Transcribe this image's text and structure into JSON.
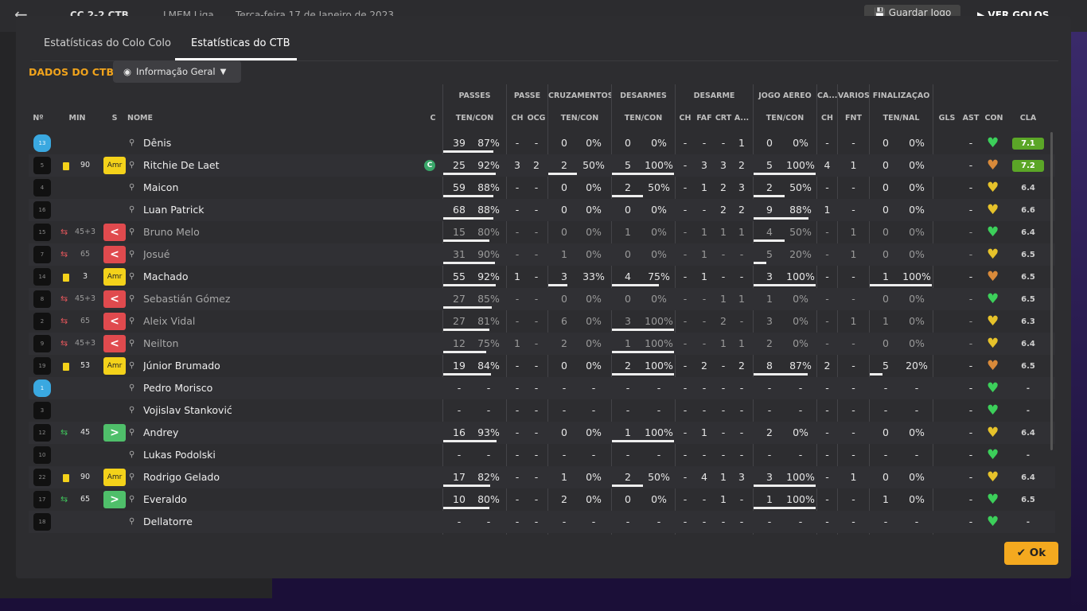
{
  "background": {
    "back_icon": "arrow-left-icon",
    "match_title": "CC 2-2 CTB",
    "competition": "LMEM Liga",
    "date": "Terça-feira 17 de Janeiro de 2023",
    "save_label": "Guardar Jogo",
    "next_label": "VER GOLOS"
  },
  "tabs": [
    {
      "label": "Estatísticas do Colo Colo"
    },
    {
      "label": "Estatísticas do CTB"
    }
  ],
  "section_title": "DADOS DO CTB",
  "view_dropdown": {
    "label": "Informação Geral",
    "icon": "eye-icon"
  },
  "group_headers": [
    {
      "key": "passes",
      "label": "PASSES"
    },
    {
      "key": "passe",
      "label": "PASSE"
    },
    {
      "key": "cruz",
      "label": "CRUZAMENTOS"
    },
    {
      "key": "desarmes",
      "label": "DESARMES"
    },
    {
      "key": "desarme",
      "label": "DESARME"
    },
    {
      "key": "aereo",
      "label": "JOGO AÉREO"
    },
    {
      "key": "ca",
      "label": "CA..."
    },
    {
      "key": "varios",
      "label": "VÁRIOS"
    },
    {
      "key": "final",
      "label": "FINALIZAÇÃO"
    }
  ],
  "columns": {
    "num": "Nº",
    "min": "MIN",
    "s": "S",
    "name": "NOME",
    "c": "C",
    "passes": "TEN/CON",
    "pch": "CH",
    "pocg": "OCG",
    "cruz": "TEN/CON",
    "des": "TEN/CON",
    "dch": "CH",
    "dfaf": "FAF",
    "dcrt": "CRT",
    "da": "A...",
    "aereo": "TEN/CON",
    "cach": "CH",
    "fnt": "FNT",
    "fin": "TEN/NAL",
    "gls": "GLS",
    "ast": "AST",
    "con": "CON",
    "cla": "CLA"
  },
  "colors": {
    "accent": "#f0a31c",
    "yellow_card": "#f4d21a",
    "sub_off": "#e04a4e",
    "sub_on": "#4fbf6a",
    "rating_high": "#5ba627",
    "heart_green": "#3ccf5a",
    "heart_yellow": "#e6c22a",
    "heart_orange": "#d98a3a"
  },
  "players": [
    {
      "num": "13",
      "gk": true,
      "min": "",
      "yellow": false,
      "sub": "",
      "badge": "",
      "name": "Dênis",
      "cap": false,
      "p_ten": "39",
      "p_pct": "87%",
      "p_bar": 0.87,
      "pch": "-",
      "pocg": "-",
      "c_ten": "0",
      "c_pct": "0%",
      "c_bar": 0,
      "d_ten": "0",
      "d_pct": "0%",
      "d_bar": 0,
      "dch": "-",
      "faf": "-",
      "crt": "-",
      "da": "1",
      "a_ten": "0",
      "a_pct": "0%",
      "a_bar": 0,
      "cach": "-",
      "fnt": "-",
      "f_ten": "0",
      "f_pct": "0%",
      "f_bar": 0,
      "gls": "",
      "ast": "-",
      "con": "green",
      "cla": "7.1",
      "hi": true
    },
    {
      "num": "5",
      "gk": false,
      "min": "90",
      "yellow": true,
      "sub": "",
      "badge": "Amr",
      "name": "Ritchie De Laet",
      "cap": true,
      "cap_label": "C",
      "p_ten": "25",
      "p_pct": "92%",
      "p_bar": 0.92,
      "pch": "3",
      "pocg": "2",
      "c_ten": "2",
      "c_pct": "50%",
      "c_bar": 0.5,
      "d_ten": "5",
      "d_pct": "100%",
      "d_bar": 1,
      "dch": "-",
      "faf": "3",
      "crt": "3",
      "da": "2",
      "a_ten": "5",
      "a_pct": "100%",
      "a_bar": 1,
      "cach": "4",
      "fnt": "1",
      "f_ten": "0",
      "f_pct": "0%",
      "f_bar": 0,
      "gls": "",
      "ast": "-",
      "con": "orange",
      "cla": "7.2",
      "hi": true
    },
    {
      "num": "4",
      "gk": false,
      "min": "",
      "yellow": false,
      "sub": "",
      "badge": "",
      "name": "Maicon",
      "cap": false,
      "p_ten": "59",
      "p_pct": "88%",
      "p_bar": 0.88,
      "pch": "-",
      "pocg": "-",
      "c_ten": "0",
      "c_pct": "0%",
      "c_bar": 0,
      "d_ten": "2",
      "d_pct": "50%",
      "d_bar": 0.5,
      "dch": "-",
      "faf": "1",
      "crt": "2",
      "da": "3",
      "a_ten": "2",
      "a_pct": "50%",
      "a_bar": 0.5,
      "cach": "-",
      "fnt": "-",
      "f_ten": "0",
      "f_pct": "0%",
      "f_bar": 0,
      "gls": "",
      "ast": "-",
      "con": "yellow",
      "cla": "6.4",
      "hi": false
    },
    {
      "num": "16",
      "gk": false,
      "min": "",
      "yellow": false,
      "sub": "",
      "badge": "",
      "name": "Luan Patrick",
      "cap": false,
      "p_ten": "68",
      "p_pct": "88%",
      "p_bar": 0.88,
      "pch": "-",
      "pocg": "-",
      "c_ten": "0",
      "c_pct": "0%",
      "c_bar": 0,
      "d_ten": "0",
      "d_pct": "0%",
      "d_bar": 0,
      "dch": "-",
      "faf": "-",
      "crt": "2",
      "da": "2",
      "a_ten": "9",
      "a_pct": "88%",
      "a_bar": 0.88,
      "cach": "1",
      "fnt": "-",
      "f_ten": "0",
      "f_pct": "0%",
      "f_bar": 0,
      "gls": "",
      "ast": "-",
      "con": "yellow",
      "cla": "6.6",
      "hi": false
    },
    {
      "num": "15",
      "gk": false,
      "min": "45+3",
      "yellow": false,
      "sub": "off",
      "badge": "<",
      "name": "Bruno Melo",
      "cap": false,
      "p_ten": "15",
      "p_pct": "80%",
      "p_bar": 0.8,
      "pch": "-",
      "pocg": "-",
      "c_ten": "0",
      "c_pct": "0%",
      "c_bar": 0,
      "d_ten": "1",
      "d_pct": "0%",
      "d_bar": 0,
      "dch": "-",
      "faf": "1",
      "crt": "1",
      "da": "1",
      "a_ten": "4",
      "a_pct": "50%",
      "a_bar": 0.5,
      "cach": "-",
      "fnt": "1",
      "f_ten": "0",
      "f_pct": "0%",
      "f_bar": 0,
      "gls": "",
      "ast": "-",
      "con": "green",
      "cla": "6.4",
      "hi": false
    },
    {
      "num": "7",
      "gk": false,
      "min": "65",
      "yellow": false,
      "sub": "off",
      "badge": "<",
      "name": "Josué",
      "cap": false,
      "p_ten": "31",
      "p_pct": "90%",
      "p_bar": 0.9,
      "pch": "-",
      "pocg": "-",
      "c_ten": "1",
      "c_pct": "0%",
      "c_bar": 0,
      "d_ten": "0",
      "d_pct": "0%",
      "d_bar": 0,
      "dch": "-",
      "faf": "1",
      "crt": "-",
      "da": "-",
      "a_ten": "5",
      "a_pct": "20%",
      "a_bar": 0.2,
      "cach": "-",
      "fnt": "1",
      "f_ten": "0",
      "f_pct": "0%",
      "f_bar": 0,
      "gls": "",
      "ast": "-",
      "con": "yellow",
      "cla": "6.5",
      "hi": false
    },
    {
      "num": "14",
      "gk": false,
      "min": "3",
      "yellow": true,
      "sub": "",
      "badge": "Amr",
      "name": "Machado",
      "cap": false,
      "p_ten": "55",
      "p_pct": "92%",
      "p_bar": 0.92,
      "pch": "1",
      "pocg": "-",
      "c_ten": "3",
      "c_pct": "33%",
      "c_bar": 0.33,
      "d_ten": "4",
      "d_pct": "75%",
      "d_bar": 0.75,
      "dch": "-",
      "faf": "1",
      "crt": "-",
      "da": "-",
      "a_ten": "3",
      "a_pct": "100%",
      "a_bar": 1,
      "cach": "-",
      "fnt": "-",
      "f_ten": "1",
      "f_pct": "100%",
      "f_bar": 1,
      "gls": "",
      "ast": "-",
      "con": "orange",
      "cla": "6.5",
      "hi": false
    },
    {
      "num": "8",
      "gk": false,
      "min": "45+3",
      "yellow": false,
      "sub": "off",
      "badge": "<",
      "name": "Sebastián Gómez",
      "cap": false,
      "p_ten": "27",
      "p_pct": "85%",
      "p_bar": 0.85,
      "pch": "-",
      "pocg": "-",
      "c_ten": "0",
      "c_pct": "0%",
      "c_bar": 0,
      "d_ten": "0",
      "d_pct": "0%",
      "d_bar": 0,
      "dch": "-",
      "faf": "-",
      "crt": "1",
      "da": "1",
      "a_ten": "1",
      "a_pct": "0%",
      "a_bar": 0,
      "cach": "-",
      "fnt": "-",
      "f_ten": "0",
      "f_pct": "0%",
      "f_bar": 0,
      "gls": "",
      "ast": "-",
      "con": "green",
      "cla": "6.5",
      "hi": false
    },
    {
      "num": "2",
      "gk": false,
      "min": "65",
      "yellow": false,
      "sub": "off",
      "badge": "<",
      "name": "Aleix Vidal",
      "cap": false,
      "p_ten": "27",
      "p_pct": "81%",
      "p_bar": 0.81,
      "pch": "-",
      "pocg": "-",
      "c_ten": "6",
      "c_pct": "0%",
      "c_bar": 0,
      "d_ten": "3",
      "d_pct": "100%",
      "d_bar": 1,
      "dch": "-",
      "faf": "-",
      "crt": "2",
      "da": "-",
      "a_ten": "3",
      "a_pct": "0%",
      "a_bar": 0,
      "cach": "-",
      "fnt": "1",
      "f_ten": "1",
      "f_pct": "0%",
      "f_bar": 0,
      "gls": "",
      "ast": "-",
      "con": "yellow",
      "cla": "6.3",
      "hi": false
    },
    {
      "num": "9",
      "gk": false,
      "min": "45+3",
      "yellow": false,
      "sub": "off",
      "badge": "<",
      "name": "Neilton",
      "cap": false,
      "p_ten": "12",
      "p_pct": "75%",
      "p_bar": 0.75,
      "pch": "1",
      "pocg": "-",
      "c_ten": "2",
      "c_pct": "0%",
      "c_bar": 0,
      "d_ten": "1",
      "d_pct": "100%",
      "d_bar": 1,
      "dch": "-",
      "faf": "-",
      "crt": "1",
      "da": "1",
      "a_ten": "2",
      "a_pct": "0%",
      "a_bar": 0,
      "cach": "-",
      "fnt": "-",
      "f_ten": "0",
      "f_pct": "0%",
      "f_bar": 0,
      "gls": "",
      "ast": "-",
      "con": "yellow",
      "cla": "6.4",
      "hi": false
    },
    {
      "num": "19",
      "gk": false,
      "min": "53",
      "yellow": true,
      "sub": "",
      "badge": "Amr",
      "name": "Júnior Brumado",
      "cap": false,
      "p_ten": "19",
      "p_pct": "84%",
      "p_bar": 0.84,
      "pch": "-",
      "pocg": "-",
      "c_ten": "0",
      "c_pct": "0%",
      "c_bar": 0,
      "d_ten": "2",
      "d_pct": "100%",
      "d_bar": 1,
      "dch": "-",
      "faf": "2",
      "crt": "-",
      "da": "2",
      "a_ten": "8",
      "a_pct": "87%",
      "a_bar": 0.87,
      "cach": "2",
      "fnt": "-",
      "f_ten": "5",
      "f_pct": "20%",
      "f_bar": 0.2,
      "gls": "",
      "ast": "-",
      "con": "orange",
      "cla": "6.5",
      "hi": false
    },
    {
      "num": "1",
      "gk": true,
      "min": "",
      "yellow": false,
      "sub": "",
      "badge": "",
      "name": "Pedro Morisco",
      "cap": false,
      "p_ten": "-",
      "p_pct": "-",
      "p_bar": 0,
      "pch": "-",
      "pocg": "-",
      "c_ten": "-",
      "c_pct": "-",
      "c_bar": 0,
      "d_ten": "-",
      "d_pct": "-",
      "d_bar": 0,
      "dch": "-",
      "faf": "-",
      "crt": "-",
      "da": "-",
      "a_ten": "-",
      "a_pct": "-",
      "a_bar": 0,
      "cach": "-",
      "fnt": "-",
      "f_ten": "-",
      "f_pct": "-",
      "f_bar": 0,
      "gls": "",
      "ast": "-",
      "con": "green",
      "cla": "-",
      "hi": false
    },
    {
      "num": "3",
      "gk": false,
      "min": "",
      "yellow": false,
      "sub": "",
      "badge": "",
      "name": "Vojislav Stanković",
      "cap": false,
      "p_ten": "-",
      "p_pct": "-",
      "p_bar": 0,
      "pch": "-",
      "pocg": "-",
      "c_ten": "-",
      "c_pct": "-",
      "c_bar": 0,
      "d_ten": "-",
      "d_pct": "-",
      "d_bar": 0,
      "dch": "-",
      "faf": "-",
      "crt": "-",
      "da": "-",
      "a_ten": "-",
      "a_pct": "-",
      "a_bar": 0,
      "cach": "-",
      "fnt": "-",
      "f_ten": "-",
      "f_pct": "-",
      "f_bar": 0,
      "gls": "",
      "ast": "-",
      "con": "green",
      "cla": "-",
      "hi": false
    },
    {
      "num": "12",
      "gk": false,
      "min": "45",
      "yellow": false,
      "sub": "on",
      "badge": ">",
      "name": "Andrey",
      "cap": false,
      "p_ten": "16",
      "p_pct": "93%",
      "p_bar": 0.93,
      "pch": "-",
      "pocg": "-",
      "c_ten": "0",
      "c_pct": "0%",
      "c_bar": 0,
      "d_ten": "1",
      "d_pct": "100%",
      "d_bar": 1,
      "dch": "-",
      "faf": "1",
      "crt": "-",
      "da": "-",
      "a_ten": "2",
      "a_pct": "0%",
      "a_bar": 0,
      "cach": "-",
      "fnt": "-",
      "f_ten": "0",
      "f_pct": "0%",
      "f_bar": 0,
      "gls": "",
      "ast": "-",
      "con": "yellow",
      "cla": "6.4",
      "hi": false
    },
    {
      "num": "10",
      "gk": false,
      "min": "",
      "yellow": false,
      "sub": "",
      "badge": "",
      "name": "Lukas Podolski",
      "cap": false,
      "p_ten": "-",
      "p_pct": "-",
      "p_bar": 0,
      "pch": "-",
      "pocg": "-",
      "c_ten": "-",
      "c_pct": "-",
      "c_bar": 0,
      "d_ten": "-",
      "d_pct": "-",
      "d_bar": 0,
      "dch": "-",
      "faf": "-",
      "crt": "-",
      "da": "-",
      "a_ten": "-",
      "a_pct": "-",
      "a_bar": 0,
      "cach": "-",
      "fnt": "-",
      "f_ten": "-",
      "f_pct": "-",
      "f_bar": 0,
      "gls": "",
      "ast": "-",
      "con": "green",
      "cla": "-",
      "hi": false
    },
    {
      "num": "22",
      "gk": false,
      "min": "90",
      "yellow": true,
      "sub": "",
      "badge": "Amr",
      "name": "Rodrigo Gelado",
      "cap": false,
      "p_ten": "17",
      "p_pct": "82%",
      "p_bar": 0.82,
      "pch": "-",
      "pocg": "-",
      "c_ten": "1",
      "c_pct": "0%",
      "c_bar": 0,
      "d_ten": "2",
      "d_pct": "50%",
      "d_bar": 0.5,
      "dch": "-",
      "faf": "4",
      "crt": "1",
      "da": "3",
      "a_ten": "3",
      "a_pct": "100%",
      "a_bar": 1,
      "cach": "-",
      "fnt": "1",
      "f_ten": "0",
      "f_pct": "0%",
      "f_bar": 0,
      "gls": "",
      "ast": "-",
      "con": "yellow",
      "cla": "6.4",
      "hi": false
    },
    {
      "num": "17",
      "gk": false,
      "min": "65",
      "yellow": false,
      "sub": "on",
      "badge": ">",
      "name": "Everaldo",
      "cap": false,
      "p_ten": "10",
      "p_pct": "80%",
      "p_bar": 0.8,
      "pch": "-",
      "pocg": "-",
      "c_ten": "2",
      "c_pct": "0%",
      "c_bar": 0,
      "d_ten": "0",
      "d_pct": "0%",
      "d_bar": 0,
      "dch": "-",
      "faf": "-",
      "crt": "1",
      "da": "-",
      "a_ten": "1",
      "a_pct": "100%",
      "a_bar": 1,
      "cach": "-",
      "fnt": "-",
      "f_ten": "1",
      "f_pct": "0%",
      "f_bar": 0,
      "gls": "",
      "ast": "-",
      "con": "green",
      "cla": "6.5",
      "hi": false
    },
    {
      "num": "18",
      "gk": false,
      "min": "",
      "yellow": false,
      "sub": "",
      "badge": "",
      "name": "Dellatorre",
      "cap": false,
      "p_ten": "-",
      "p_pct": "-",
      "p_bar": 0,
      "pch": "-",
      "pocg": "-",
      "c_ten": "-",
      "c_pct": "-",
      "c_bar": 0,
      "d_ten": "-",
      "d_pct": "-",
      "d_bar": 0,
      "dch": "-",
      "faf": "-",
      "crt": "-",
      "da": "-",
      "a_ten": "-",
      "a_pct": "-",
      "a_bar": 0,
      "cach": "-",
      "fnt": "-",
      "f_ten": "-",
      "f_pct": "-",
      "f_bar": 0,
      "gls": "",
      "ast": "-",
      "con": "green",
      "cla": "-",
      "hi": false
    }
  ],
  "ok_label": "Ok"
}
